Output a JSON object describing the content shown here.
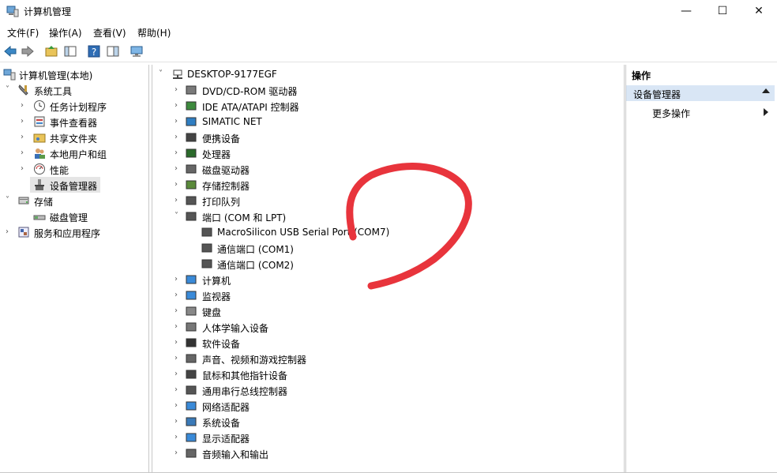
{
  "window": {
    "title": "计算机管理",
    "minimize": "—",
    "maximize": "☐",
    "close": "✕"
  },
  "menu": {
    "file": "文件(F)",
    "action": "操作(A)",
    "view": "查看(V)",
    "help": "帮助(H)"
  },
  "left_tree": {
    "root": "计算机管理(本地)",
    "system_tools": "系统工具",
    "task_scheduler": "任务计划程序",
    "event_viewer": "事件查看器",
    "shared_folders": "共享文件夹",
    "local_users": "本地用户和组",
    "performance": "性能",
    "device_manager": "设备管理器",
    "storage": "存储",
    "disk_management": "磁盘管理",
    "services": "服务和应用程序"
  },
  "device_tree": {
    "computer": "DESKTOP-9177EGF",
    "categories": [
      "DVD/CD-ROM 驱动器",
      "IDE ATA/ATAPI 控制器",
      "SIMATIC NET",
      "便携设备",
      "处理器",
      "磁盘驱动器",
      "存储控制器",
      "打印队列",
      "端口 (COM 和 LPT)",
      "计算机",
      "监视器",
      "键盘",
      "人体学输入设备",
      "软件设备",
      "声音、视频和游戏控制器",
      "鼠标和其他指针设备",
      "通用串行总线控制器",
      "网络适配器",
      "系统设备",
      "显示适配器",
      "音频输入和输出"
    ],
    "ports": [
      "MacroSilicon USB Serial Port (COM7)",
      "通信端口 (COM1)",
      "通信端口 (COM2)"
    ]
  },
  "actions": {
    "header": "操作",
    "section": "设备管理器",
    "more": "更多操作"
  },
  "colors": {
    "selection": "#e5e5e5",
    "action_section": "#d9e6f5",
    "scribble": "#e8343c"
  }
}
